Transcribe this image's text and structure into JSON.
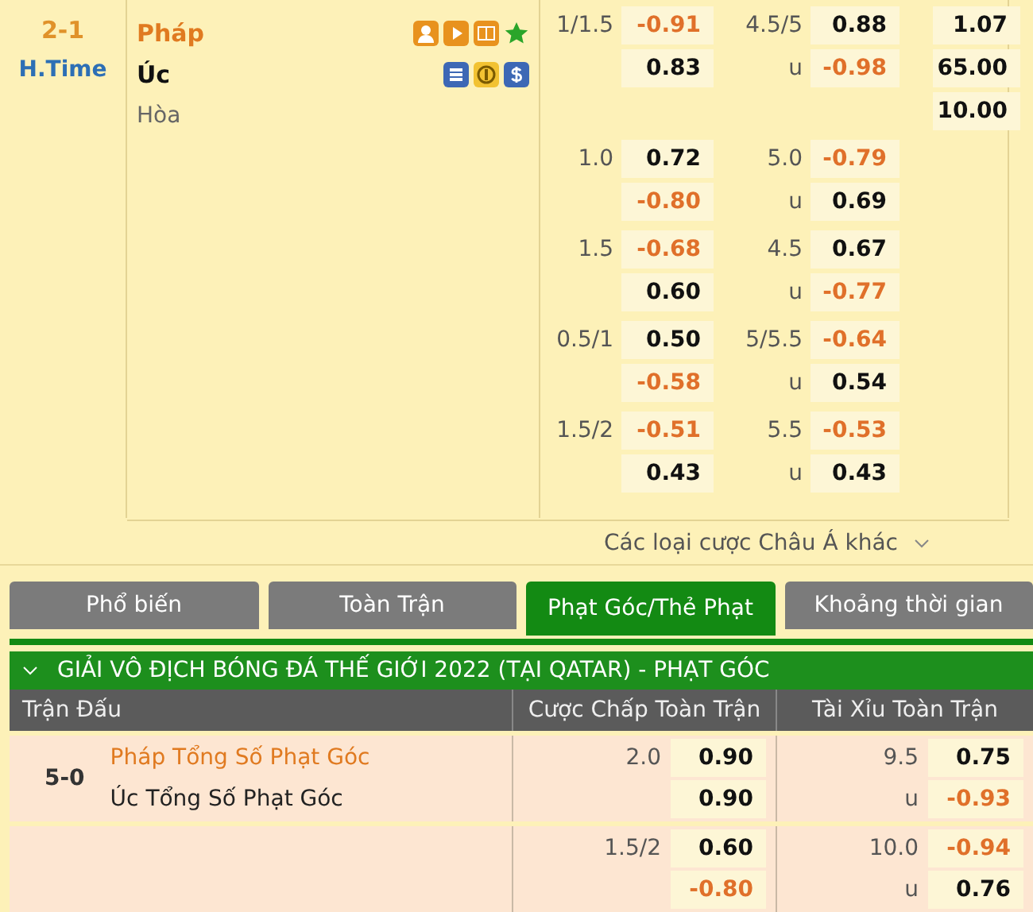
{
  "match": {
    "score": "2-1",
    "status": "H.Time",
    "home": {
      "name": "Pháp",
      "favorite": true
    },
    "away": {
      "name": "Úc",
      "favorite": false
    },
    "draw": "Hòa"
  },
  "groups": [
    {
      "handicap": {
        "line": "1/1.5",
        "home": {
          "value": "-0.91",
          "negative": true
        },
        "away": {
          "value": "0.83",
          "negative": false
        }
      },
      "total": {
        "line": "4.5/5",
        "under_label": "u",
        "over": {
          "value": "0.88",
          "negative": false
        },
        "under": {
          "value": "-0.98",
          "negative": true
        }
      },
      "x12": [
        "1.07",
        "65.00",
        "10.00"
      ]
    },
    {
      "handicap": {
        "line": "1.0",
        "home": {
          "value": "0.72",
          "negative": false
        },
        "away": {
          "value": "-0.80",
          "negative": true
        }
      },
      "total": {
        "line": "5.0",
        "under_label": "u",
        "over": {
          "value": "-0.79",
          "negative": true
        },
        "under": {
          "value": "0.69",
          "negative": false
        }
      }
    },
    {
      "handicap": {
        "line": "1.5",
        "home": {
          "value": "-0.68",
          "negative": true
        },
        "away": {
          "value": "0.60",
          "negative": false
        }
      },
      "total": {
        "line": "4.5",
        "under_label": "u",
        "over": {
          "value": "0.67",
          "negative": false
        },
        "under": {
          "value": "-0.77",
          "negative": true
        }
      }
    },
    {
      "handicap": {
        "line": "0.5/1",
        "home": {
          "value": "0.50",
          "negative": false
        },
        "away": {
          "value": "-0.58",
          "negative": true
        }
      },
      "total": {
        "line": "5/5.5",
        "under_label": "u",
        "over": {
          "value": "-0.64",
          "negative": true
        },
        "under": {
          "value": "0.54",
          "negative": false
        }
      }
    },
    {
      "handicap": {
        "line": "1.5/2",
        "home": {
          "value": "-0.51",
          "negative": true
        },
        "away": {
          "value": "0.43",
          "negative": false
        }
      },
      "total": {
        "line": "5.5",
        "under_label": "u",
        "over": {
          "value": "-0.53",
          "negative": true
        },
        "under": {
          "value": "0.43",
          "negative": false
        }
      }
    }
  ],
  "more_link": "Các loại cược Châu Á khác",
  "tabs": [
    {
      "label": "Phổ biến",
      "selected": false
    },
    {
      "label": "Toàn Trận",
      "selected": false
    },
    {
      "label": "Phạt Góc/Thẻ Phạt",
      "selected": true
    },
    {
      "label": "Khoảng thời gian",
      "selected": false
    }
  ],
  "league": {
    "title": "GIẢI VÔ ĐỊCH BÓNG ĐÁ THẾ GIỚI 2022 (TẠI QATAR) - PHẠT GÓC",
    "expanded": true
  },
  "columns": [
    "Trận Đấu",
    "Cược Chấp Toàn Trận",
    "Tài Xỉu Toàn Trận"
  ],
  "rows": [
    {
      "score": "5-0",
      "home": {
        "name": "Pháp Tổng Số Phạt Góc",
        "favorite": true
      },
      "away": {
        "name": "Úc Tổng Số Phạt Góc",
        "favorite": false
      },
      "handicap": {
        "line": "2.0",
        "home": {
          "value": "0.90",
          "negative": false
        },
        "away": {
          "value": "0.90",
          "negative": false
        }
      },
      "total": {
        "line": "9.5",
        "under_label": "u",
        "over": {
          "value": "0.75",
          "negative": false
        },
        "under": {
          "value": "-0.93",
          "negative": true
        }
      }
    },
    {
      "handicap": {
        "line": "1.5/2",
        "home": {
          "value": "0.60",
          "negative": false
        },
        "away": {
          "value": "-0.80",
          "negative": true
        }
      },
      "total": {
        "line": "10.0",
        "under_label": "u",
        "over": {
          "value": "-0.94",
          "negative": true
        },
        "under": {
          "value": "0.76",
          "negative": false
        }
      }
    }
  ]
}
